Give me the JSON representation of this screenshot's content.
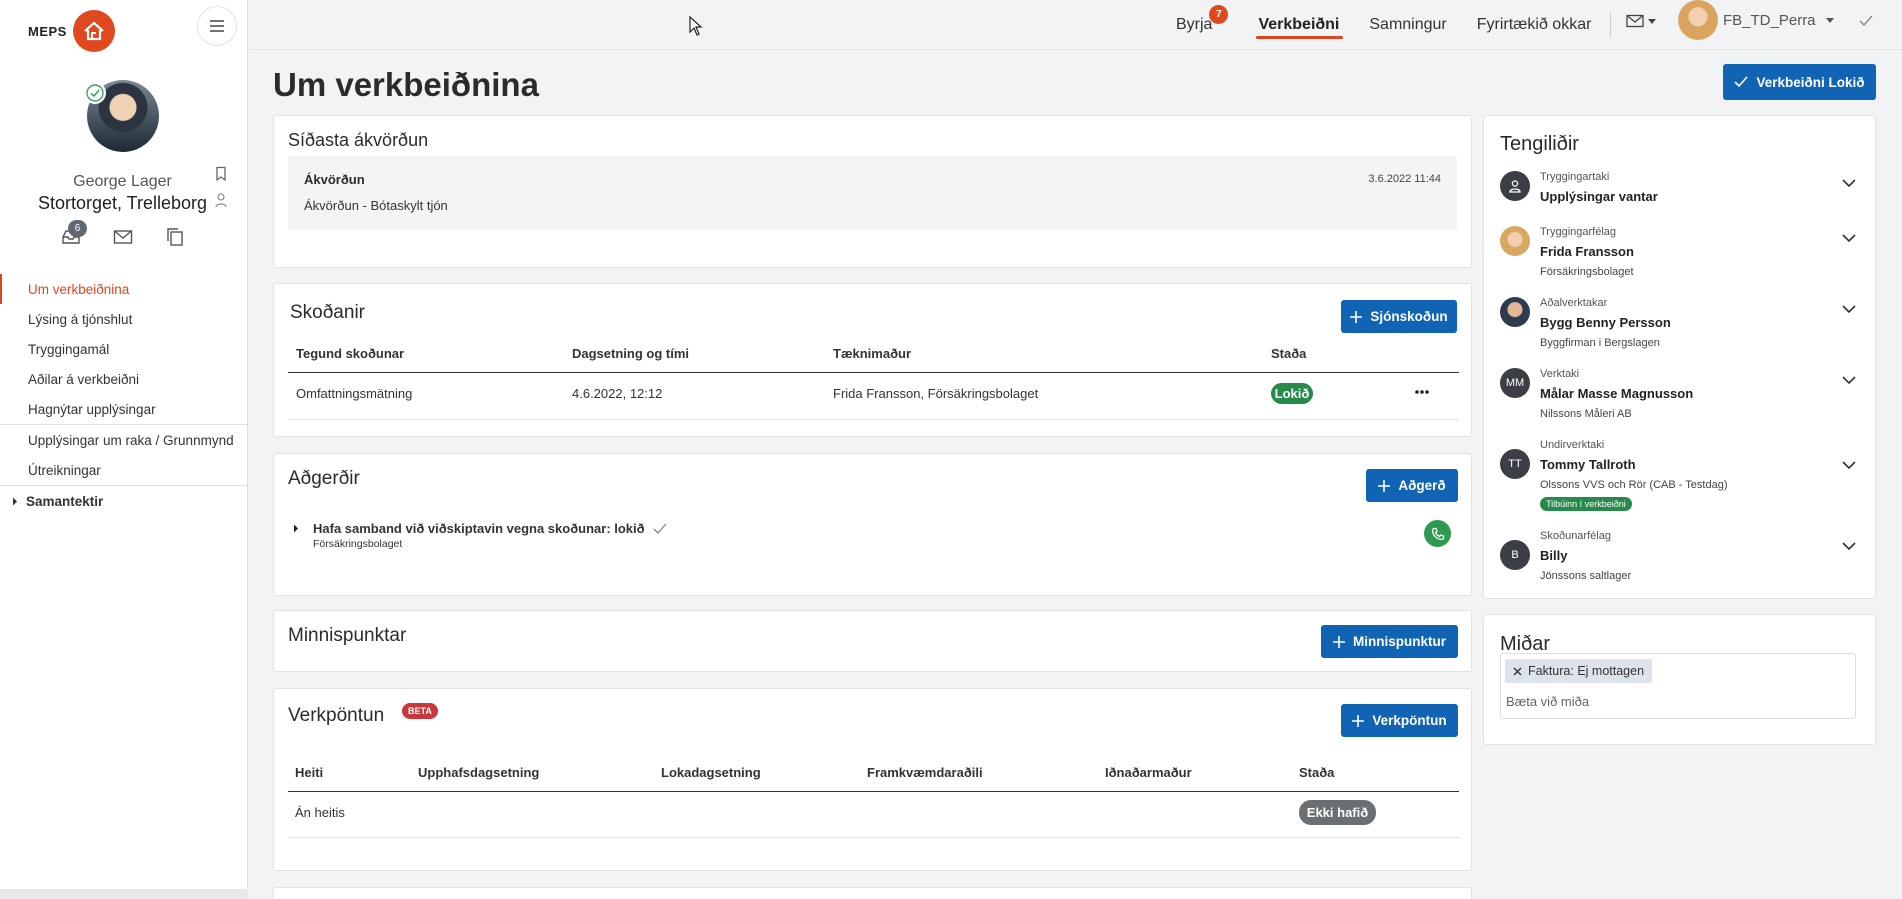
{
  "sidebar": {
    "logo_text": "MEPS",
    "user_name": "George Lager",
    "user_location": "Stortorget, Trelleborg",
    "inbox_badge": "6",
    "nav": [
      {
        "label": "Um verkbeiðnina"
      },
      {
        "label": "Lýsing á tjónshlut"
      },
      {
        "label": "Tryggingamál"
      },
      {
        "label": "Aðilar á verkbeiðni"
      },
      {
        "label": "Hagnýtar upplýsingar"
      },
      {
        "label": "Upplýsingar um raka / Grunnmynd"
      },
      {
        "label": "Útreikningar"
      },
      {
        "label": "Samantektir"
      }
    ]
  },
  "topbar": {
    "nav": [
      {
        "label": "Byrja",
        "badge": "7"
      },
      {
        "label": "Verkbeiðni"
      },
      {
        "label": "Samningur"
      },
      {
        "label": "Fyrirtækið okkar"
      }
    ],
    "username": "FB_TD_Perra"
  },
  "main": {
    "title": "Um verkbeiðnina",
    "complete_button": "Verkbeiðni Lokið",
    "last_decision": {
      "title": "Síðasta ákvörðun",
      "heading": "Ákvörðun",
      "date": "3.6.2022 11:44",
      "text": "Ákvörðun - Bótaskylt tjón"
    },
    "inspections": {
      "title": "Skoðanir",
      "add_button": "Sjónskoðun",
      "headers": [
        "Tegund skoðunar",
        "Dagsetning og tími",
        "Tæknimaður",
        "Staða"
      ],
      "rows": [
        {
          "type": "Omfattningsmätning",
          "datetime": "4.6.2022, 12:12",
          "technician": "Frida Fransson, Försäkringsbolaget",
          "status": "Lokið"
        }
      ]
    },
    "actions": {
      "title": "Aðgerðir",
      "add_button": "Aðgerð",
      "items": [
        {
          "title": "Hafa samband við viðskiptavin vegna skoðunar: lokið",
          "subtitle": "Försäkringsbolaget"
        }
      ]
    },
    "notes": {
      "title": "Minnispunktar",
      "add_button": "Minnispunktur"
    },
    "work_orders": {
      "title": "Verkpöntun",
      "beta": "BETA",
      "add_button": "Verkpöntun",
      "headers": [
        "Heiti",
        "Upphafsdagsetning",
        "Lokadagsetning",
        "Framkvæmdaraðili",
        "Iðnaðarmaður",
        "Staða"
      ],
      "rows": [
        {
          "name": "Án heitis",
          "status": "Ekki hafið"
        }
      ]
    }
  },
  "contacts": {
    "title": "Tengiliðir",
    "items": [
      {
        "role": "Tryggingartaki",
        "name": "Upplýsingar vantar",
        "company": "",
        "initials": "",
        "icon": "person-icon"
      },
      {
        "role": "Tryggingarfélag",
        "name": "Frida Fransson",
        "company": "Försäkringsbolaget",
        "initials": "",
        "icon": "photo"
      },
      {
        "role": "Aðalverktakar",
        "name": "Bygg Benny Persson",
        "company": "Byggfirman i Bergslagen",
        "initials": "",
        "icon": "photo"
      },
      {
        "role": "Verktaki",
        "name": "Målar Masse Magnusson",
        "company": "Nilssons Måleri AB",
        "initials": "MM",
        "icon": "initials"
      },
      {
        "role": "Undirverktaki",
        "name": "Tommy Tallroth",
        "company": "Olssons VVS och Rör (CAB - Testdag)",
        "initials": "TT",
        "icon": "initials",
        "tag": "Tilbúinn í verkbeiðni"
      },
      {
        "role": "Skoðunarfélag",
        "name": "Billy",
        "company": "Jönssons saltlager",
        "initials": "B",
        "icon": "initials"
      }
    ]
  },
  "tags": {
    "title": "Miðar",
    "items": [
      "Faktura: Ej mottagen"
    ],
    "placeholder": "Bæta við miða"
  },
  "colors": {
    "accent": "#d9461f",
    "primary_button": "#1164b4",
    "status_done": "#268a4a",
    "status_not_started": "#6a6f74"
  }
}
